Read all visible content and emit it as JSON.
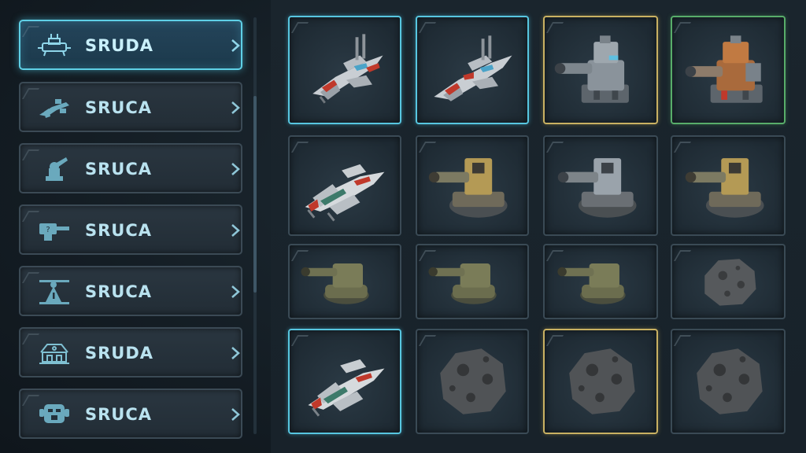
{
  "sidebar": {
    "items": [
      {
        "label": "SRUDA",
        "icon": "ship-icon",
        "active": true
      },
      {
        "label": "SRUCA",
        "icon": "fighter-icon",
        "active": false
      },
      {
        "label": "SRUCA",
        "icon": "cannon-icon",
        "active": false
      },
      {
        "label": "SRUCA",
        "icon": "turret-icon",
        "active": false
      },
      {
        "label": "SRUCA",
        "icon": "tower-icon",
        "active": false
      },
      {
        "label": "SRUDA",
        "icon": "base-icon",
        "active": false
      },
      {
        "label": "SRUCA",
        "icon": "robot-icon",
        "active": false
      }
    ]
  },
  "grid": {
    "rows": [
      [
        {
          "item": "spaceship-silver",
          "frame": "cyan"
        },
        {
          "item": "spaceship-silver",
          "frame": "cyan"
        },
        {
          "item": "turret-gray",
          "frame": "gold"
        },
        {
          "item": "turret-orange",
          "frame": "green"
        }
      ],
      [
        {
          "item": "spaceship-white",
          "frame": "default"
        },
        {
          "item": "cannon-bronze",
          "frame": "default"
        },
        {
          "item": "cannon-steel",
          "frame": "default"
        },
        {
          "item": "cannon-bronze",
          "frame": "default"
        }
      ],
      [
        {
          "item": "turret-olive",
          "frame": "default"
        },
        {
          "item": "turret-olive",
          "frame": "default"
        },
        {
          "item": "turret-olive",
          "frame": "default"
        },
        {
          "item": "asteroid",
          "frame": "default"
        }
      ],
      [
        {
          "item": "spaceship-white",
          "frame": "cyan"
        },
        {
          "item": "asteroid",
          "frame": "default"
        },
        {
          "item": "asteroid",
          "frame": "gold"
        },
        {
          "item": "asteroid",
          "frame": "default"
        }
      ]
    ]
  },
  "colors": {
    "accent_cyan": "#5fd0e6",
    "frame_gold": "#c9b162",
    "frame_green": "#58ad6a",
    "label_text": "#b9e2ef"
  }
}
